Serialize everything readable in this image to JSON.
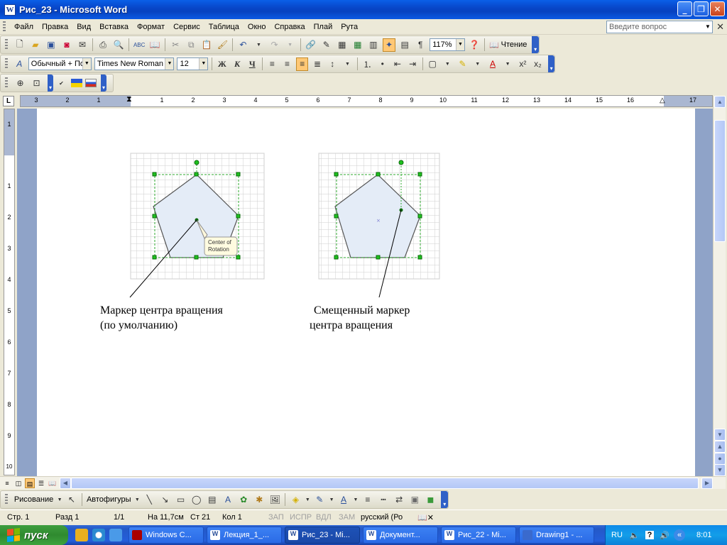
{
  "window": {
    "title": "Рис_23 - Microsoft Word",
    "app_icon_letter": "W"
  },
  "menu": {
    "items": [
      "Файл",
      "Правка",
      "Вид",
      "Вставка",
      "Формат",
      "Сервис",
      "Таблица",
      "Окно",
      "Справка",
      "Плай",
      "Рута"
    ],
    "help_placeholder": "Введите вопрос"
  },
  "standard_toolbar": {
    "zoom": "117%",
    "read_label": "Чтение"
  },
  "format_toolbar": {
    "style": "Обычный + По г",
    "font": "Times New Roman",
    "size": "12",
    "bold": "Ж",
    "italic": "К",
    "underline": "Ч"
  },
  "ruler": {
    "numbers": [
      "3",
      "2",
      "1",
      "1",
      "2",
      "3",
      "4",
      "5",
      "6",
      "7",
      "8",
      "9",
      "10",
      "11",
      "12",
      "13",
      "14",
      "15",
      "16",
      "17"
    ]
  },
  "vruler": {
    "numbers": [
      "1",
      "1",
      "2",
      "3",
      "4",
      "5",
      "6",
      "7",
      "8",
      "9",
      "10"
    ]
  },
  "document": {
    "callout_text_line1": "Center of",
    "callout_text_line2": "Rotation",
    "left_caption_line1": "Маркер центра вращения",
    "left_caption_line2": "(по умолчанию)",
    "right_caption_line1": "Смещенный маркер",
    "right_caption_line2": "центра вращения"
  },
  "drawing_toolbar": {
    "draw_label": "Рисование",
    "autoshapes_label": "Автофигуры"
  },
  "status": {
    "page": "Стр. 1",
    "section": "Разд 1",
    "pages": "1/1",
    "at": "На 11,7см",
    "line": "Ст 21",
    "col": "Кол 1",
    "rec": "ЗАП",
    "trk": "ИСПР",
    "ext": "ВДЛ",
    "ovr": "ЗАМ",
    "lang": "русский (Ро"
  },
  "taskbar": {
    "start_label": "пуск",
    "tasks": [
      "Windows C...",
      "Лекция_1_...",
      "Рис_23 - Mi...",
      "Документ...",
      "Рис_22 - Mi...",
      "Drawing1 - ..."
    ],
    "lang": "RU",
    "clock": "8:01"
  }
}
